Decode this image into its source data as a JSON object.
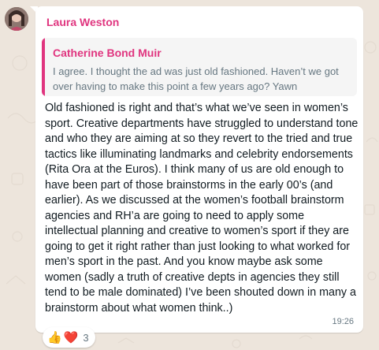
{
  "message": {
    "sender_name": "Laura Weston",
    "quoted": {
      "author": "Catherine Bond Muir",
      "text": "I agree. I thought the ad was just old fashioned. Haven’t we got over having to make this point a few years ago? Yawn"
    },
    "body": "Old fashioned is right and that’s what we’ve seen in women’s sport. Creative departments have struggled to understand tone and who they are aiming at so they revert to the tried and true tactics like illuminating landmarks and celebrity endorsements (Rita Ora at the Euros). I think many of us are old enough to have been part of those brainstorms in the early 00’s (and earlier). As we discussed at the women’s football brainstorm  agencies and RH’a are going to need to apply some intellectual planning and creative to women’s sport if they are going to get it right rather than just looking to what worked for men’s sport in the past.  And you know maybe ask some women (sadly a truth of creative depts in agencies they still tend to be male dominated) I’ve been shouted down in many a brainstorm about what women think..)",
    "time": "19:26",
    "reactions": {
      "emojis": [
        "👍",
        "❤️"
      ],
      "count": "3"
    }
  },
  "colors": {
    "sender": "#e0357f",
    "quote_bar": "#e0357f",
    "background": "#ede5dc",
    "bubble": "#ffffff"
  }
}
